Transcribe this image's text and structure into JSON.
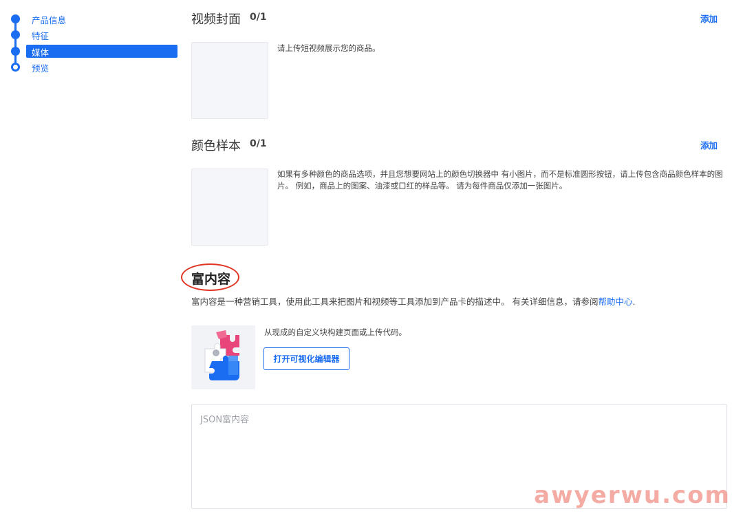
{
  "sidebar": {
    "steps": [
      {
        "label": "产品信息"
      },
      {
        "label": "特征"
      },
      {
        "label": "媒体"
      },
      {
        "label": "预览"
      }
    ],
    "active_index": 2
  },
  "video_cover": {
    "title": "视频封面",
    "count": "0/1",
    "add_label": "添加",
    "description": "请上传短视频展示您的商品。"
  },
  "color_swatch": {
    "title": "颜色样本",
    "count": "0/1",
    "add_label": "添加",
    "description_line1": "如果有多种颜色的商品选项，并且您想要网站上的颜色切换器中 有小图片，而不是标准圆形按钮，请上传包含商品颜色样本的图",
    "description_line2": "片。 例如，商品上的图案、油漆或口红的样品等。 请为每件商品仅添加一张图片。"
  },
  "rich_content": {
    "title": "富内容",
    "description": "富内容是一种营销工具，使用此工具来把图片和视频等工具添加到产品卡的描述中。 有关详细信息，请参阅",
    "help_link": "帮助中心",
    "help_suffix": ".",
    "builder_text": "从现成的自定义块构建页面或上传代码。",
    "editor_button": "打开可视化编辑器",
    "json_placeholder": "JSON富内容"
  },
  "watermark": "awyerwu.com",
  "colors": {
    "accent": "#1a6cf0",
    "annotation_circle": "#e03524"
  }
}
